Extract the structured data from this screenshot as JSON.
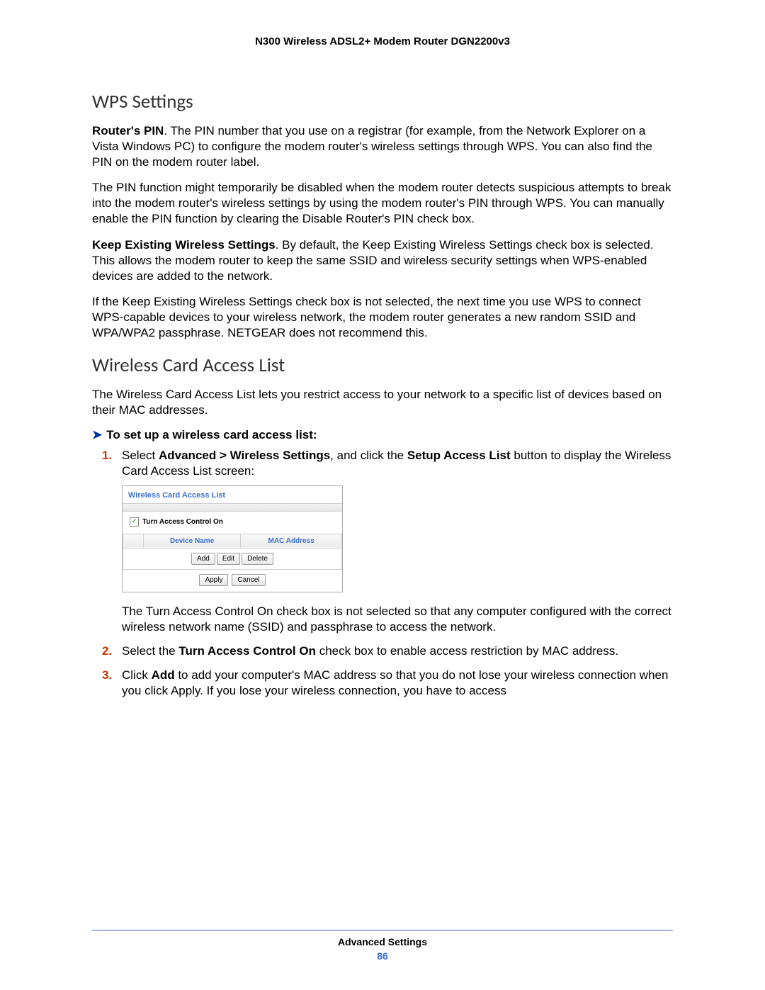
{
  "header": "N300 Wireless ADSL2+ Modem Router DGN2200v3",
  "h1": "WPS Settings",
  "p1a": "Router's PIN",
  "p1b": ". The PIN number that you use on a registrar (for example, from the Network Explorer on a Vista Windows PC) to configure the modem router's wireless settings through WPS. You can also find the PIN on the modem router label.",
  "p2": "The PIN function might temporarily be disabled when the modem router detects suspicious attempts to break into the modem router's wireless settings by using the modem router's PIN through WPS. You can manually enable the PIN function by clearing the Disable Router's PIN check box.",
  "p3a": "Keep Existing Wireless Settings",
  "p3b": ". By default, the Keep Existing Wireless Settings check box is selected. This allows the modem router to keep the same SSID and wireless security settings when WPS-enabled devices are added to the network.",
  "p4": "If the Keep Existing Wireless Settings check box is not selected, the next time you use WPS to connect WPS-capable devices to your wireless network, the modem router generates a new random SSID and WPA/WPA2 passphrase. NETGEAR does not recommend this.",
  "h2": "Wireless Card Access List",
  "p5": "The Wireless Card Access List lets you restrict access to your network to a specific list of devices based on their MAC addresses.",
  "arrow": "To set up a wireless card access list:",
  "s1a": "Select ",
  "s1b": "Advanced > Wireless Settings",
  "s1c": ", and click the ",
  "s1d": "Setup Access List",
  "s1e": " button to display the Wireless Card Access List screen:",
  "shot": {
    "title": "Wireless Card Access List",
    "checkbox": "Turn Access Control On",
    "col_blank": "",
    "col1": "Device Name",
    "col2": "MAC Address",
    "b_add": "Add",
    "b_edit": "Edit",
    "b_delete": "Delete",
    "b_apply": "Apply",
    "b_cancel": "Cancel"
  },
  "p6": "The Turn Access Control On check box is not selected so that any computer configured with the correct wireless network name (SSID) and passphrase to access the network.",
  "s2a": "Select the ",
  "s2b": "Turn Access Control On",
  "s2c": " check box to enable access restriction by MAC address.",
  "s3a": "Click ",
  "s3b": "Add",
  "s3c": " to add your computer's MAC address so that you do not lose your wireless connection when you click Apply. If you lose your wireless connection, you have to access",
  "footer_title": "Advanced Settings",
  "footer_page": "86"
}
